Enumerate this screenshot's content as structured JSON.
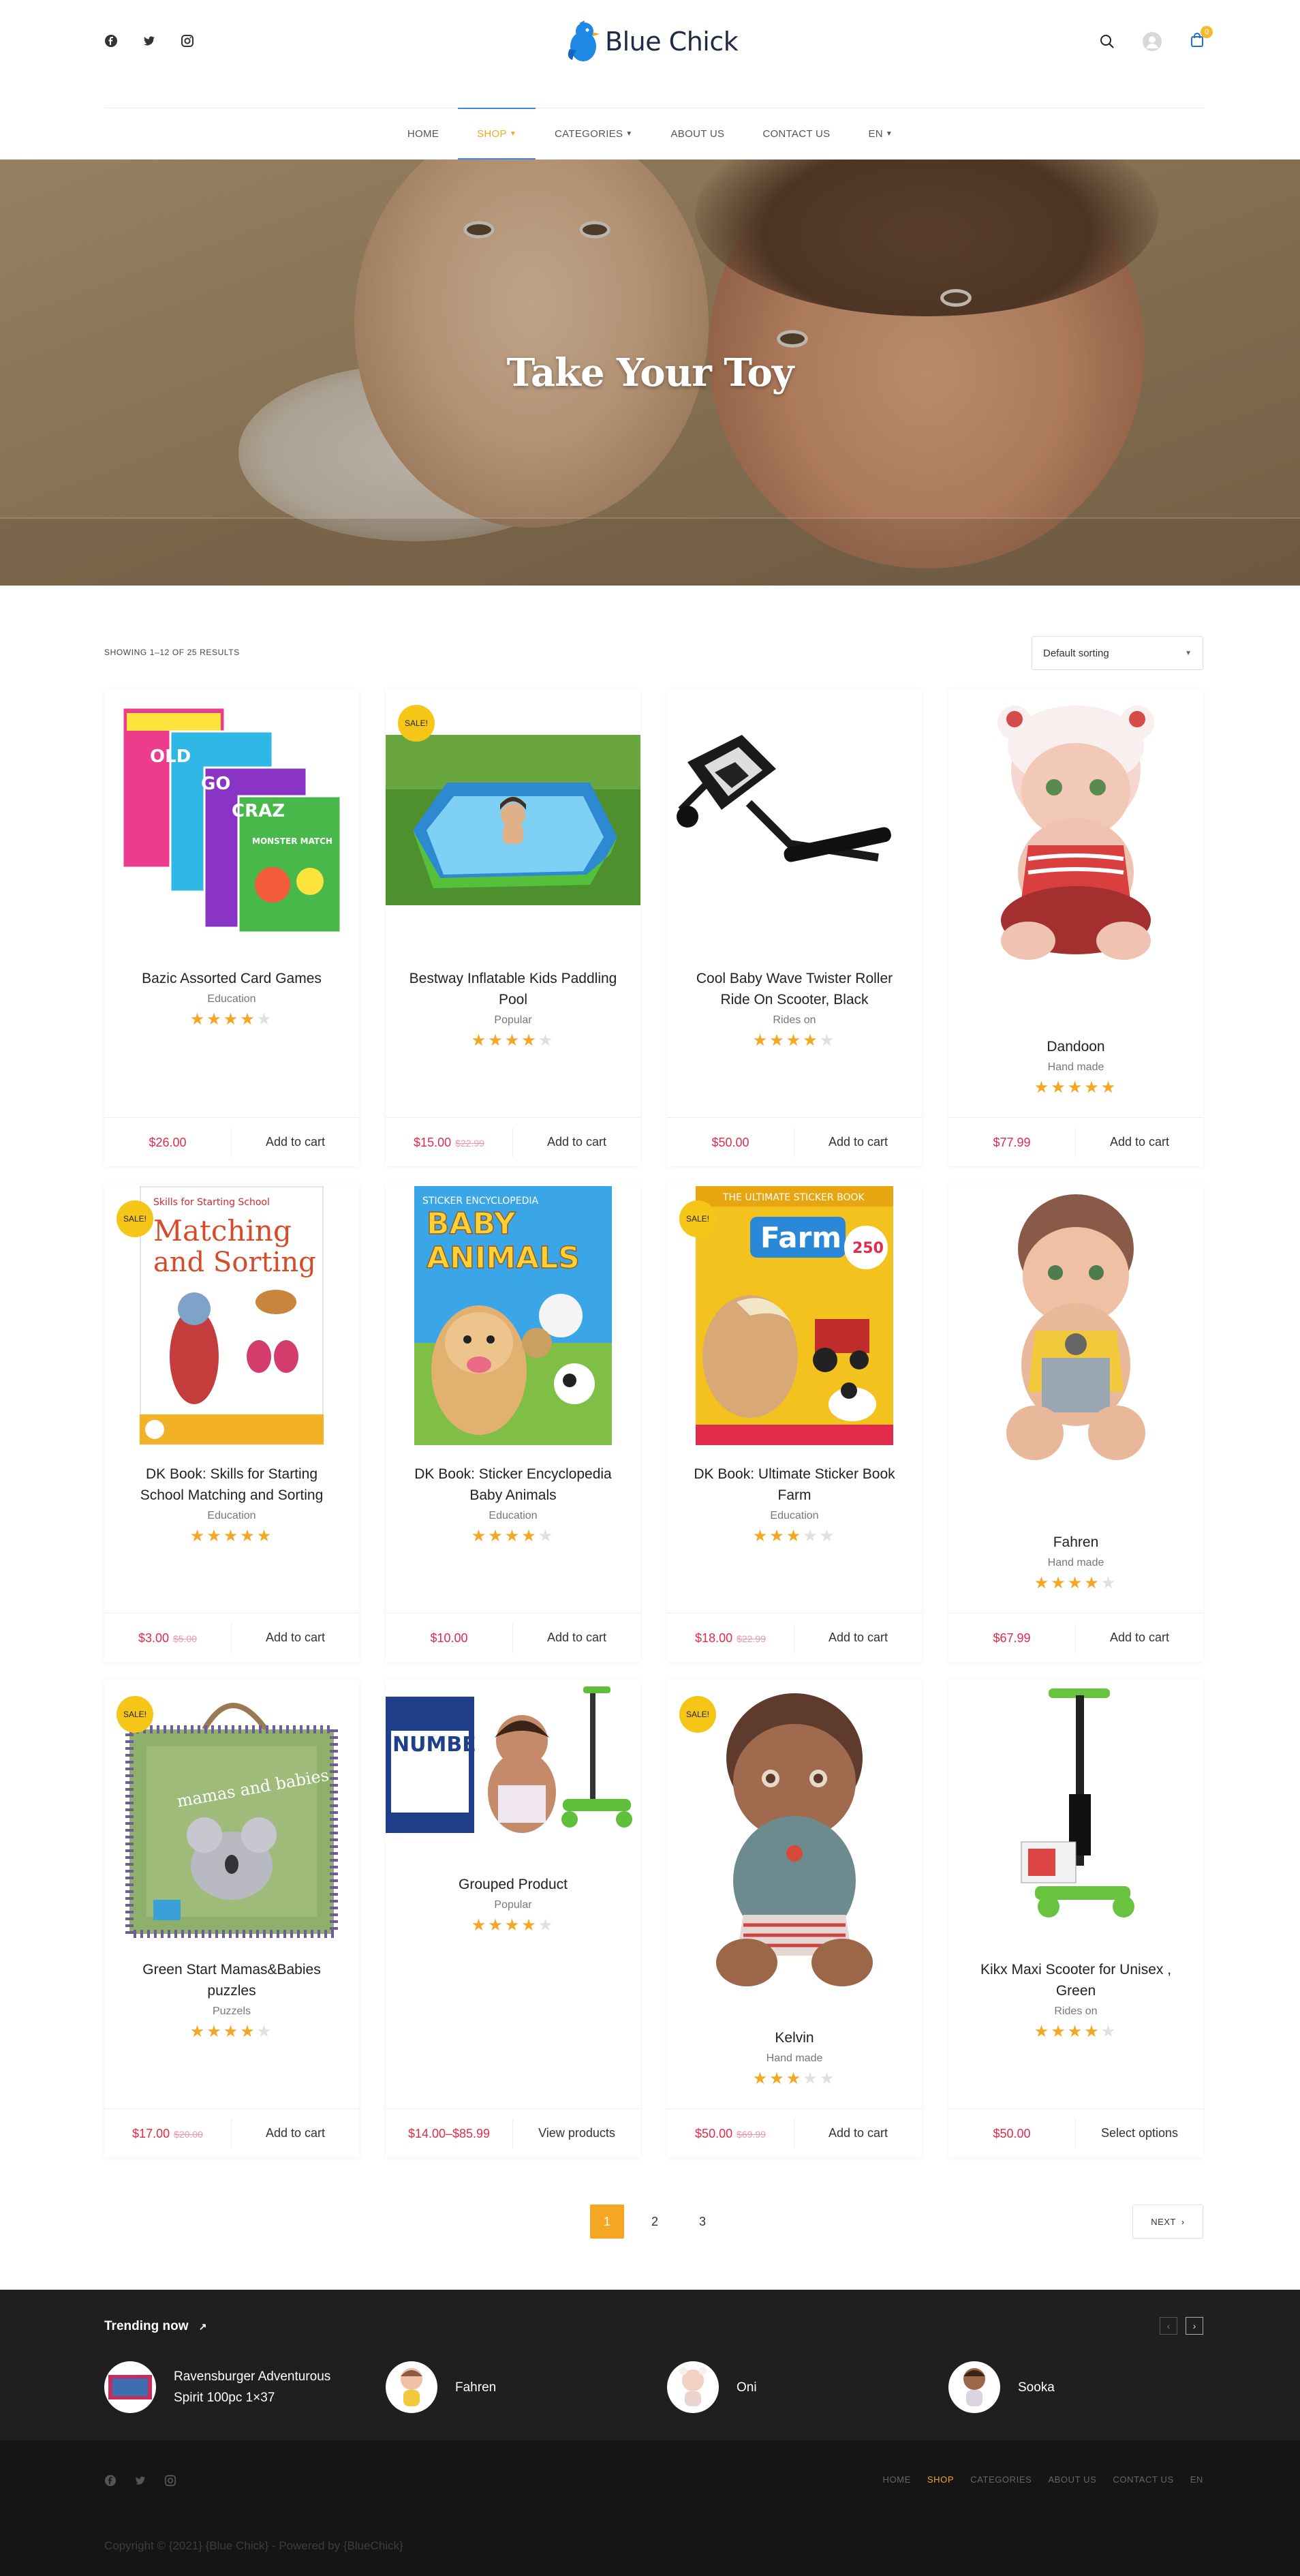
{
  "header": {
    "brand": "Blue Chick",
    "cart_count": "0",
    "social_icons": [
      "facebook-icon",
      "twitter-icon",
      "instagram-icon"
    ]
  },
  "nav": {
    "items": [
      {
        "label": "HOME",
        "dropdown": false,
        "active": false
      },
      {
        "label": "SHOP",
        "dropdown": true,
        "active": true
      },
      {
        "label": "CATEGORIES",
        "dropdown": true,
        "active": false
      },
      {
        "label": "ABOUT US",
        "dropdown": false,
        "active": false
      },
      {
        "label": "CONTACT US",
        "dropdown": false,
        "active": false
      },
      {
        "label": "EN",
        "dropdown": true,
        "active": false
      }
    ]
  },
  "hero": {
    "title": "Take Your Toy"
  },
  "shop": {
    "results": "SHOWING 1–12 OF 25 RESULTS",
    "sorting": "Default sorting"
  },
  "products": [
    {
      "title": "Bazic Assorted Card Games",
      "category": "Education",
      "rating": 4,
      "price": "$26.00",
      "old_price": "",
      "action": "Add to cart",
      "sale": false
    },
    {
      "title": "Bestway Inflatable Kids Paddling Pool",
      "category": "Popular",
      "rating": 4,
      "price": "$15.00",
      "old_price": "$22.99",
      "action": "Add to cart",
      "sale": true
    },
    {
      "title": "Cool Baby Wave Twister Roller Ride On Scooter, Black",
      "category": "Rides on",
      "rating": 4,
      "price": "$50.00",
      "old_price": "",
      "action": "Add to cart",
      "sale": false
    },
    {
      "title": "Dandoon",
      "category": "Hand made",
      "rating": 5,
      "price": "$77.99",
      "old_price": "",
      "action": "Add to cart",
      "sale": false
    },
    {
      "title": "DK Book: Skills for Starting School Matching and Sorting",
      "category": "Education",
      "rating": 5,
      "price": "$3.00",
      "old_price": "$5.00",
      "action": "Add to cart",
      "sale": true
    },
    {
      "title": "DK Book: Sticker Encyclopedia Baby Animals",
      "category": "Education",
      "rating": 4,
      "price": "$10.00",
      "old_price": "",
      "action": "Add to cart",
      "sale": false
    },
    {
      "title": "DK Book: Ultimate Sticker Book Farm",
      "category": "Education",
      "rating": 3,
      "price": "$18.00",
      "old_price": "$22.99",
      "action": "Add to cart",
      "sale": true
    },
    {
      "title": "Fahren",
      "category": "Hand made",
      "rating": 4,
      "price": "$67.99",
      "old_price": "",
      "action": "Add to cart",
      "sale": false
    },
    {
      "title": "Green Start Mamas&Babies puzzles",
      "category": "Puzzels",
      "rating": 4,
      "price": "$17.00",
      "old_price": "$20.00",
      "action": "Add to cart",
      "sale": true
    },
    {
      "title": "Grouped Product",
      "category": "Popular",
      "rating": 4,
      "price": "$14.00–$85.99",
      "old_price": "",
      "action": "View products",
      "sale": false
    },
    {
      "title": "Kelvin",
      "category": "Hand made",
      "rating": 3,
      "price": "$50.00",
      "old_price": "$69.99",
      "action": "Add to cart",
      "sale": true
    },
    {
      "title": "Kikx Maxi Scooter for Unisex , Green",
      "category": "Rides on",
      "rating": 4,
      "price": "$50.00",
      "old_price": "",
      "action": "Select options",
      "sale": false
    }
  ],
  "sale_badge": "SALE!",
  "product_art": {
    "p1": {
      "lines": [
        "OLD",
        "GO",
        "CRAZ",
        "MONSTER MATCH"
      ]
    },
    "p5": {
      "line1": "Skills for Starting School",
      "line2": "Matching",
      "line3": "and Sorting"
    },
    "p6": {
      "line1": "STICKER ENCYCLOPEDIA",
      "line2": "BABY",
      "line3": "ANIMALS"
    },
    "p7": {
      "line1": "THE ULTIMATE STICKER BOOK",
      "line2": "Farm",
      "badge": "250"
    },
    "p9": {
      "line1": "mamas and babies"
    },
    "p10": {
      "line1": "NUMBE"
    }
  },
  "pagination": {
    "pages": [
      "1",
      "2",
      "3"
    ],
    "next": "NEXT"
  },
  "trending": {
    "title": "Trending now",
    "items": [
      "Ravensburger Adventurous Spirit 100pc 1×37",
      "Fahren",
      "Oni",
      "Sooka"
    ]
  },
  "footer": {
    "nav": [
      {
        "label": "HOME",
        "active": false
      },
      {
        "label": "SHOP",
        "active": true
      },
      {
        "label": "CATEGORIES",
        "active": false
      },
      {
        "label": "ABOUT US",
        "active": false
      },
      {
        "label": "CONTACT US",
        "active": false
      },
      {
        "label": "EN",
        "active": false
      }
    ],
    "copyright": "Copyright © {2021} {Blue Chick} - Powered by {BlueChick}"
  },
  "colors": {
    "accent": "#f5a623",
    "price": "#e02b4a",
    "nav_active_line": "#3d8be6",
    "footer_bg": "#151516"
  }
}
